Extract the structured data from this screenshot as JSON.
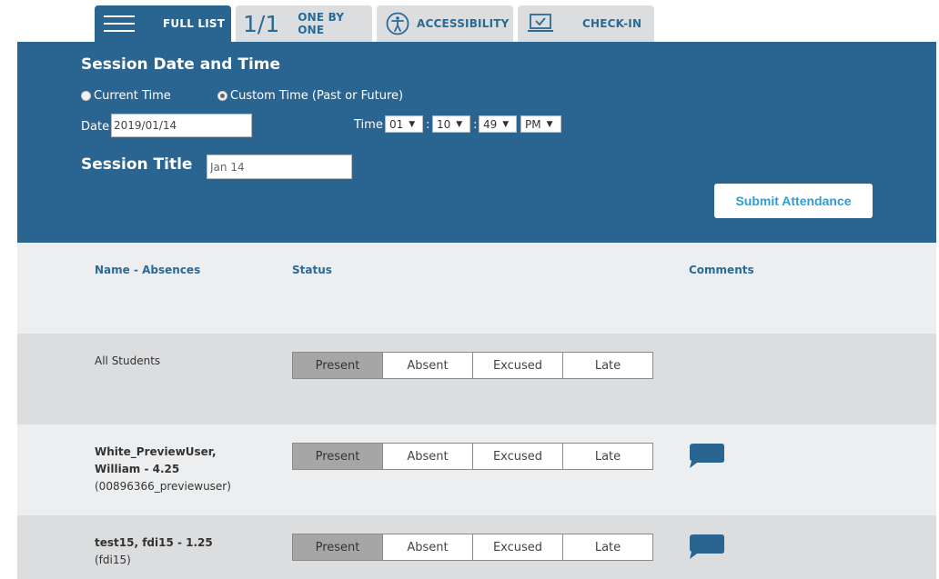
{
  "tabs": {
    "full_list": "FULL LIST",
    "one_by_one_ratio": "1/1",
    "one_by_one": "ONE BY ONE",
    "accessibility": "ACCESSIBILITY",
    "check_in": "CHECK-IN"
  },
  "session": {
    "heading": "Session Date and Time",
    "current_time_label": "Current Time",
    "custom_time_label": "Custom Time (Past or Future)",
    "selected_option": "custom",
    "date_label": "Date",
    "date_value": "2019/01/14",
    "time_label": "Time",
    "hour": "01",
    "minute": "10",
    "second": "49",
    "ampm": "PM",
    "title_label": "Session Title",
    "title_value": "Jan 14"
  },
  "submit_label": "Submit Attendance",
  "table": {
    "col_name": "Name - Absences",
    "col_status": "Status",
    "col_comments": "Comments",
    "status_options": [
      "Present",
      "Absent",
      "Excused",
      "Late"
    ],
    "all_students_label": "All Students",
    "students": [
      {
        "name_line1": "White_PreviewUser,",
        "name_line2": "William - 4.25",
        "username": "(00896366_previewuser)",
        "status": "Present"
      },
      {
        "name_line1": "test15, fdi15 - 1.25",
        "name_line2": "",
        "username": "(fdi15)",
        "status": "Present"
      }
    ]
  },
  "colors": {
    "panel_blue": "#2a6592",
    "accent_link": "#2a9ed6",
    "selected_gray": "#a6a6a6"
  }
}
